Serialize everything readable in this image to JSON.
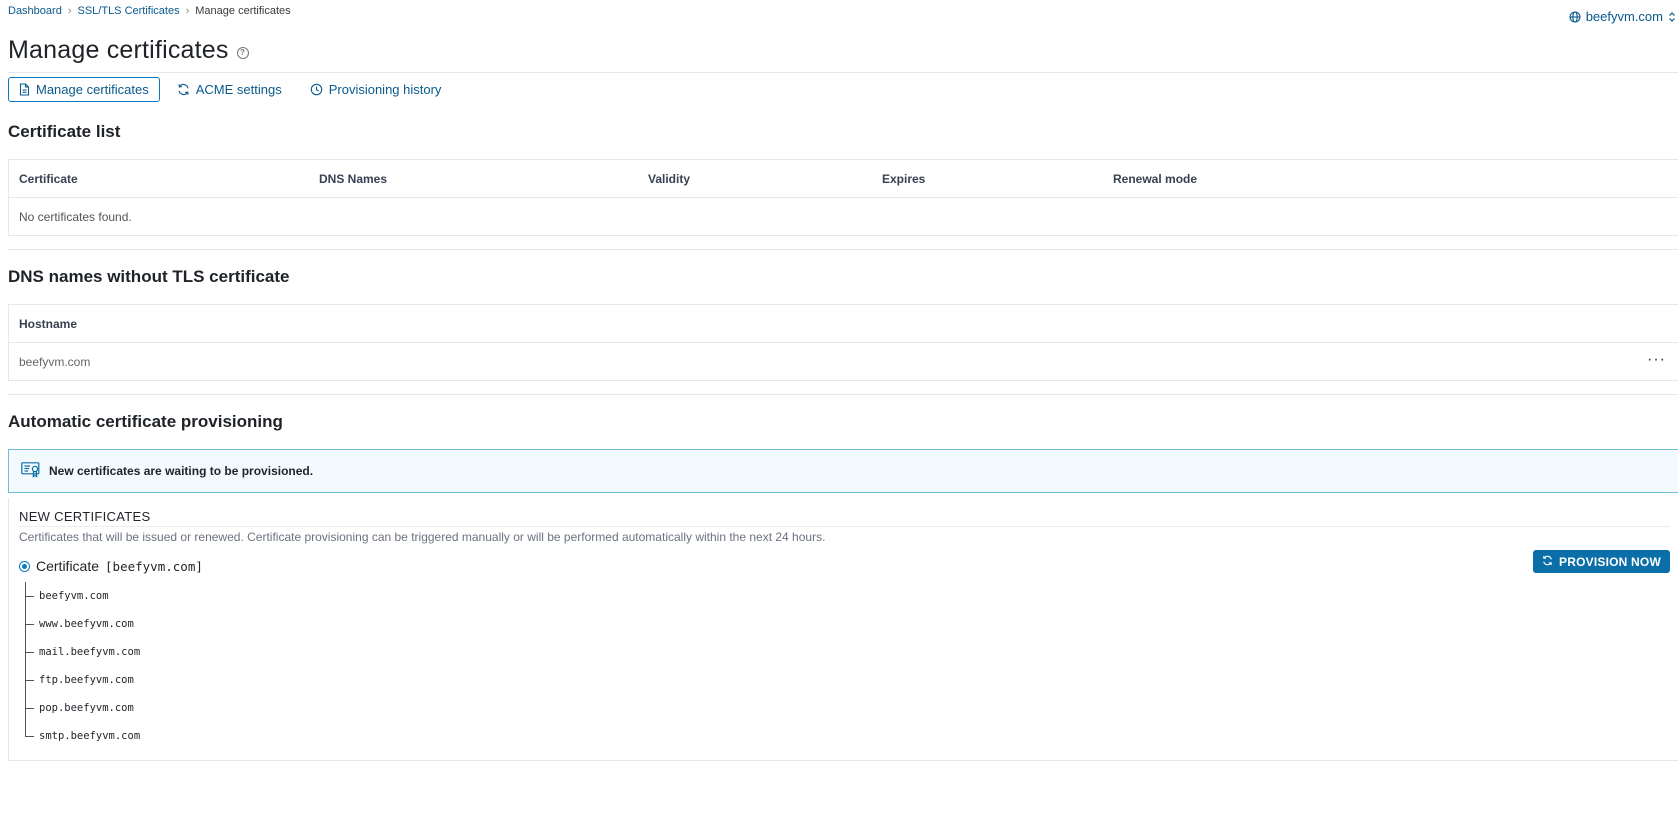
{
  "breadcrumb": {
    "items": [
      "Dashboard",
      "SSL/TLS Certificates"
    ],
    "current": "Manage certificates"
  },
  "domain_switcher": {
    "label": "beefyvm.com"
  },
  "page": {
    "title": "Manage certificates"
  },
  "tabs": [
    {
      "label": "Manage certificates",
      "icon": "document-icon",
      "active": true
    },
    {
      "label": "ACME settings",
      "icon": "refresh-icon",
      "active": false
    },
    {
      "label": "Provisioning history",
      "icon": "clock-icon",
      "active": false
    }
  ],
  "certificate_list": {
    "title": "Certificate list",
    "columns": [
      "Certificate",
      "DNS Names",
      "Validity",
      "Expires",
      "Renewal mode"
    ],
    "empty_text": "No certificates found."
  },
  "dns_without_tls": {
    "title": "DNS names without TLS certificate",
    "columns": [
      "Hostname"
    ],
    "rows": [
      {
        "hostname": "beefyvm.com",
        "menu": "···"
      }
    ]
  },
  "provisioning": {
    "title": "Automatic certificate provisioning",
    "banner_text": "New certificates are waiting to be provisioned.",
    "panel_title": "NEW CERTIFICATES",
    "panel_desc": "Certificates that will be issued or renewed. Certificate provisioning can be triggered manually or will be performed automatically within the next 24 hours.",
    "certificate_prefix": "Certificate",
    "certificate_name": "[beefyvm.com]",
    "names": [
      "beefyvm.com",
      "www.beefyvm.com",
      "mail.beefyvm.com",
      "ftp.beefyvm.com",
      "pop.beefyvm.com",
      "smtp.beefyvm.com"
    ],
    "provision_button": "PROVISION NOW"
  },
  "colors": {
    "link": "#0a5a8c",
    "accent": "#0a6ea8",
    "banner_bg": "#f2fafd",
    "banner_border": "#6fbbd8"
  }
}
